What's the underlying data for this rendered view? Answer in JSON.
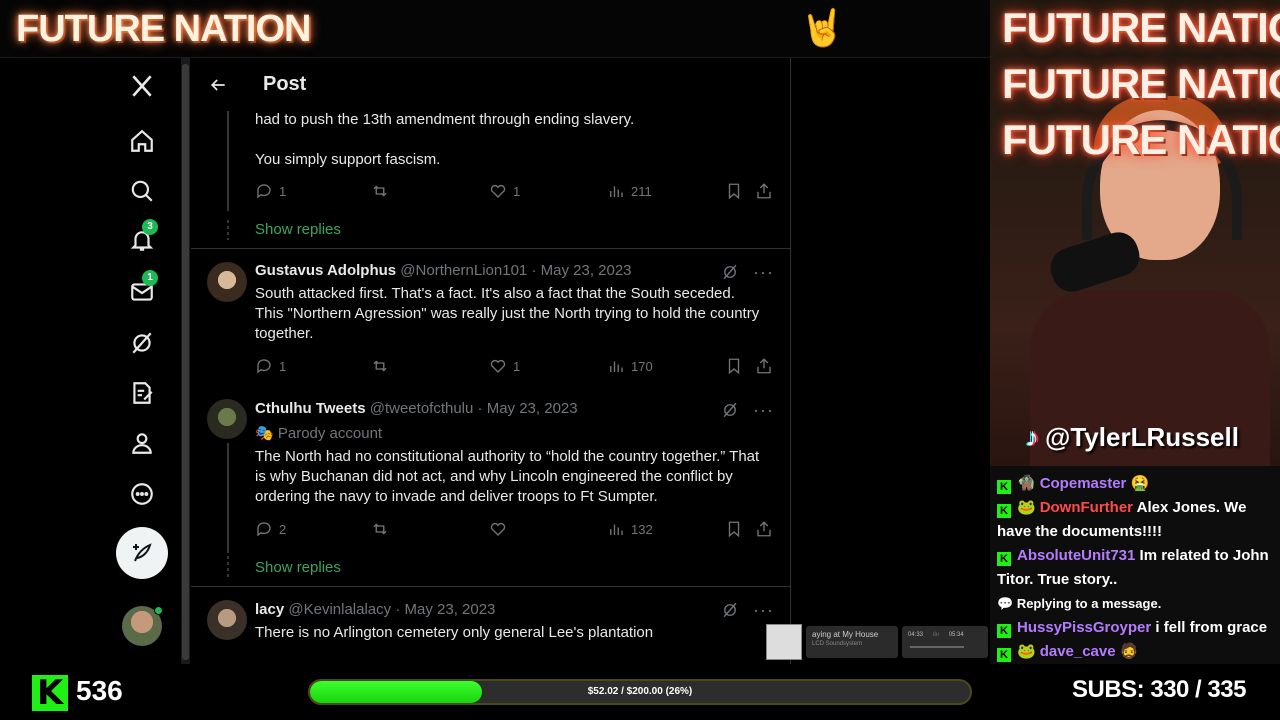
{
  "banner": {
    "title": "FUTURE NATION",
    "hand_icon": "rock-on-hand-icon"
  },
  "sidebar": {
    "items": [
      {
        "name": "x-logo",
        "icon": "x-logo-icon"
      },
      {
        "name": "home",
        "icon": "home-icon"
      },
      {
        "name": "explore",
        "icon": "search-icon"
      },
      {
        "name": "notifications",
        "icon": "bell-icon",
        "badge": "3"
      },
      {
        "name": "messages",
        "icon": "mail-icon",
        "badge": "1"
      },
      {
        "name": "grok",
        "icon": "grok-icon"
      },
      {
        "name": "drafts",
        "icon": "compose-list-icon"
      },
      {
        "name": "profile",
        "icon": "person-icon"
      },
      {
        "name": "more",
        "icon": "more-circle-icon"
      }
    ]
  },
  "header": {
    "title": "Post"
  },
  "thread_top": {
    "text_partial": "had to push the 13th amendment through ending slavery.",
    "text_second": "You simply support fascism.",
    "replies": "1",
    "likes": "1",
    "views": "211",
    "show_replies": "Show replies"
  },
  "tweets": [
    {
      "name": "Gustavus Adolphus",
      "handle": "@NorthernLion101",
      "date": "May 23, 2023",
      "text": "South attacked first. That's a fact. It's also a fact that the South seceded. This \"Northern Agression\" was really just the North trying to hold the country together.",
      "replies": "1",
      "likes": "1",
      "views": "170"
    },
    {
      "name": "Cthulhu Tweets",
      "handle": "@tweetofcthulu",
      "date": "May 23, 2023",
      "label": "Parody account",
      "text": "The North had no constitutional authority to “hold the country together.” That is why Buchanan did not act, and why Lincoln engineered the conflict by ordering the navy to invade and deliver troops to Ft Sumpter.",
      "replies": "2",
      "likes": "",
      "views": "132",
      "show_replies": "Show replies"
    },
    {
      "name": "lacy",
      "handle": "@Kevinlalalacy",
      "date": "May 23, 2023",
      "text": "There is no Arlington cemetery only general Lee's plantation"
    }
  ],
  "music": {
    "title": "aying at My House",
    "subtitle": "LCD Soundsystem",
    "elapsed": "04:33",
    "total": "05:34"
  },
  "stream": {
    "title_lines": [
      "FUTURE NATION",
      "FUTURE NATION",
      "FUTURE NATION"
    ],
    "tiktok_handle": "@TylerLRussell"
  },
  "chat": [
    {
      "user": "Copemaster",
      "color": "purple",
      "text": ""
    },
    {
      "user": "DownFurther",
      "color": "red",
      "text": "Alex Jones. We have the documents!!!!"
    },
    {
      "user": "AbsoluteUnit731",
      "color": "purple",
      "text": "Im related to John Titor. True story.."
    },
    {
      "reply_label": "Replying to a message."
    },
    {
      "user": "HussyPissGroyper",
      "color": "purple",
      "text": "i fell from grace"
    },
    {
      "user": "dave_cave",
      "color": "purple",
      "text": ""
    }
  ],
  "bottom": {
    "viewers": "536",
    "goal_text": "$52.02 / $200.00 (26%)",
    "goal_progress": 0.26,
    "subs_label": "SUBS:",
    "subs_value": "330 / 335"
  },
  "colors": {
    "kick_green": "#1ff016",
    "show_replies_green": "#3ba55d",
    "chat_purple": "#b57bff",
    "chat_red": "#ff4a4a"
  }
}
